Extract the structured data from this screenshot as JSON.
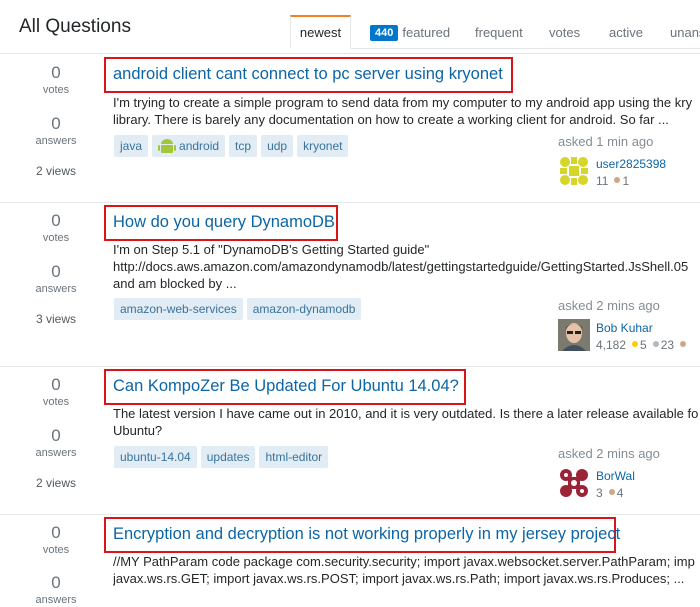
{
  "page": {
    "title": "All Questions"
  },
  "tabs": [
    {
      "label": "newest"
    },
    {
      "badge": "440",
      "label": "featured"
    },
    {
      "label": "frequent"
    },
    {
      "label": "votes"
    },
    {
      "label": "active"
    },
    {
      "label": "unans"
    }
  ],
  "colors": {
    "accent": "#f48024",
    "link": "#0c65a5",
    "tag_bg": "#e1ecf4",
    "tag_text": "#39739d",
    "highlight_box": "#d9141a"
  },
  "questions": [
    {
      "votes": "0",
      "votes_label": "votes",
      "answers": "0",
      "answers_label": "answers",
      "views": "2 views",
      "title": "android client cant connect to pc server using kryonet",
      "excerpt": "I'm trying to create a simple program to send data from my computer to my android app using the kry\nlibrary. There is barely any documentation on how to create a working client for android. So far ...",
      "tags": [
        "java",
        "android",
        "tcp",
        "udp",
        "kryonet"
      ],
      "asked": "asked 1 min ago",
      "user": "user2825398",
      "rep": "11",
      "badges": {
        "bronze": "1"
      }
    },
    {
      "votes": "0",
      "votes_label": "votes",
      "answers": "0",
      "answers_label": "answers",
      "views": "3 views",
      "title": "How do you query DynamoDB",
      "excerpt": "I'm on Step 5.1 of \"DynamoDB's Getting Started guide\"\nhttp://docs.aws.amazon.com/amazondynamodb/latest/gettingstartedguide/GettingStarted.JsShell.05\nand am blocked by ...",
      "tags": [
        "amazon-web-services",
        "amazon-dynamodb"
      ],
      "asked": "asked 2 mins ago",
      "user": "Bob Kuhar",
      "rep": "4,182",
      "badges": {
        "gold": "5",
        "silver": "23"
      }
    },
    {
      "votes": "0",
      "votes_label": "votes",
      "answers": "0",
      "answers_label": "answers",
      "views": "2 views",
      "title": "Can KompoZer Be Updated For Ubuntu 14.04?",
      "excerpt": "The latest version I have came out in 2010, and it is very outdated. Is there a later release available fo\nUbuntu?",
      "tags": [
        "ubuntu-14.04",
        "updates",
        "html-editor"
      ],
      "asked": "asked 2 mins ago",
      "user": "BorWal",
      "rep": "3",
      "badges": {
        "bronze": "4"
      }
    },
    {
      "votes": "0",
      "votes_label": "votes",
      "answers": "0",
      "answers_label": "answers",
      "title": "Encryption and decryption is not working properly in my jersey project",
      "excerpt": "//MY PathParam code package com.security.security; import javax.websocket.server.PathParam; imp\njavax.ws.rs.GET; import javax.ws.rs.POST; import javax.ws.rs.Path; import javax.ws.rs.Produces; ..."
    }
  ]
}
